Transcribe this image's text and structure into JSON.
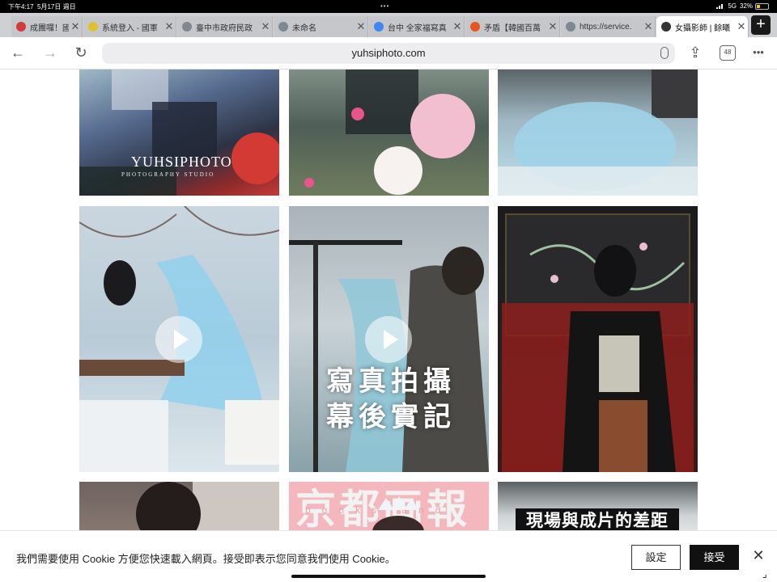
{
  "status": {
    "time": "下午4:17",
    "date": "5月17日 週日",
    "network": "5G",
    "battery": "32%",
    "battery_level": 0.32
  },
  "tabs": [
    {
      "title": "成團囉！國臣",
      "favicon_color": "#d23b3b"
    },
    {
      "title": "系統登入 - 國軍",
      "favicon_color": "#e0c030"
    },
    {
      "title": "臺中市政府民政",
      "favicon_color": "#7f8790"
    },
    {
      "title": "未命名",
      "favicon_color": "#7f8790"
    },
    {
      "title": "台中 全家福寫真",
      "favicon_color": "#4285f4"
    },
    {
      "title": "矛盾【韓國百萬",
      "favicon_color": "#e8561f"
    },
    {
      "title": "https://service.",
      "favicon_color": "#7f8790"
    },
    {
      "title": "女攝影師 | 餘曦",
      "favicon_color": "#333333"
    }
  ],
  "toolbar": {
    "url": "yuhsiphoto.com",
    "tab_count": "48",
    "back_icon": "←",
    "forward_icon": "→",
    "reload_icon": "↻",
    "share_icon": "⇪",
    "more_icon": "•••"
  },
  "gallery": {
    "watermark_title": "YUHSIPHOTO",
    "watermark_sub": "PHOTOGRAPHY STUDIO",
    "video_overlay_line1": "寫真拍攝",
    "video_overlay_line2": "幕後實記",
    "pink_title": "京都画報",
    "pink_sub": "books and",
    "black_caption": "現場與成片的差距"
  },
  "cookie": {
    "message": "我們需要使用 Cookie 方便您快速載入網頁。接受即表示您同意我們使用 Cookie。",
    "settings_label": "設定",
    "accept_label": "接受",
    "close_icon": "✕"
  }
}
